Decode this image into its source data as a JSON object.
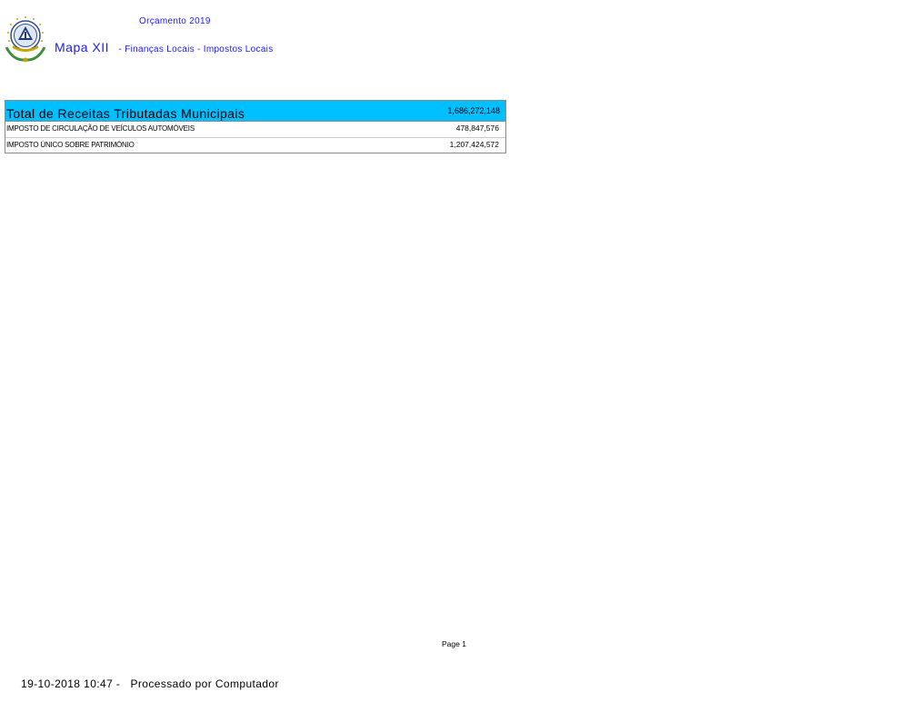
{
  "header": {
    "budget_title": "Orçamento 2019",
    "map_name": "Mapa XII",
    "map_subtitle": "- Finanças Locais - Impostos Locais"
  },
  "colors": {
    "header_blue": "#1a1aff",
    "total_row_bg": "#00bfff"
  },
  "emblem": {
    "icon": "cape-verde-coat-of-arms-icon"
  },
  "table": {
    "total_label": "Total de Receitas Tributadas Municipais",
    "total_value": "1,686,272,148",
    "rows": [
      {
        "label": "IMPOSTO DE CIRCULAÇÃO DE VEÍCULOS AUTOMÓVEIS",
        "value": "478,847,576"
      },
      {
        "label": "IMPOSTO ÚNICO SOBRE PATRIMÓNIO",
        "value": "1,207,424,572"
      }
    ]
  },
  "page": {
    "label": "Page 1"
  },
  "footer": {
    "text": "19-10-2018 10:47 -   Processado por Computador"
  }
}
